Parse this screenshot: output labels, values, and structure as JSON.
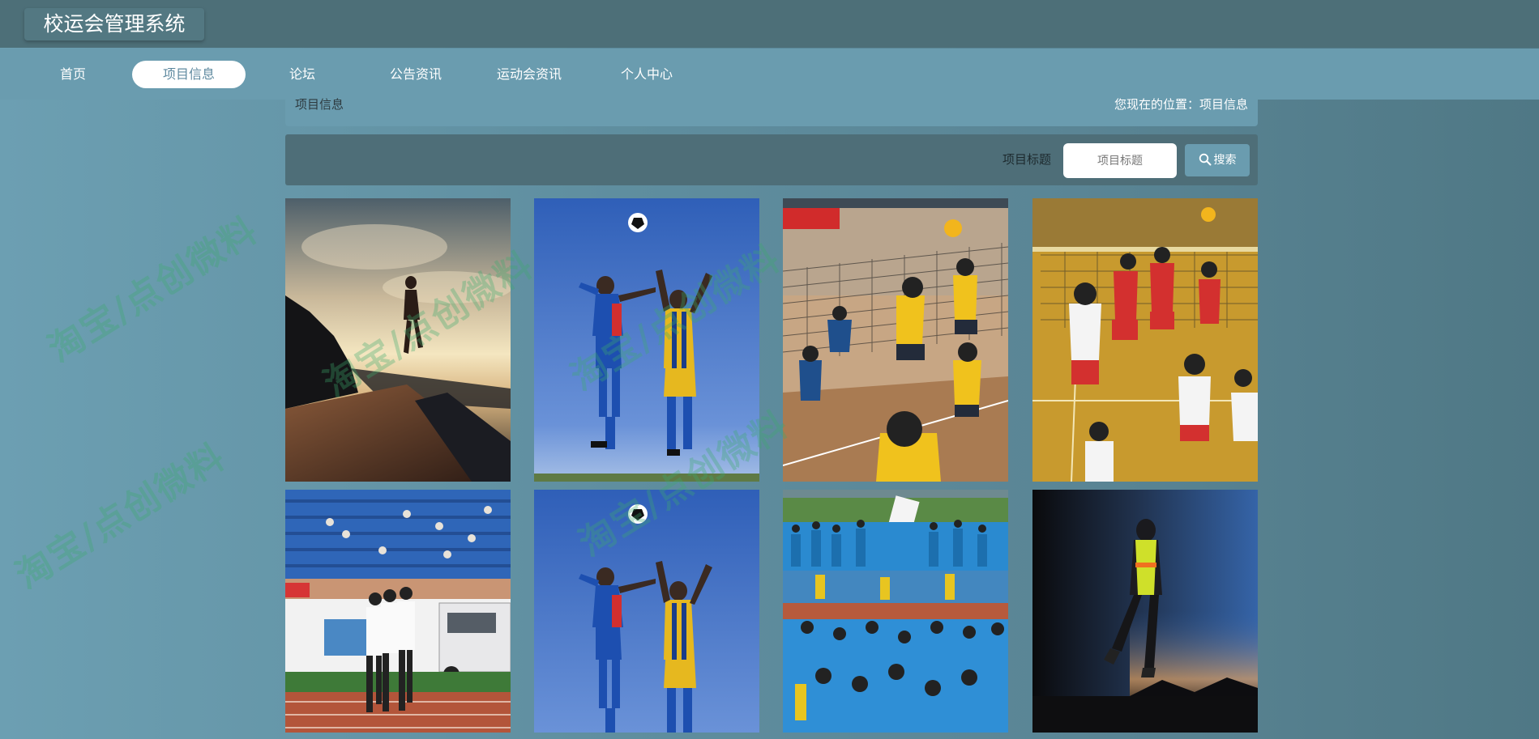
{
  "header": {
    "title": "校运会管理系统"
  },
  "nav": {
    "items": [
      {
        "label": "首页"
      },
      {
        "label": "项目信息"
      },
      {
        "label": "论坛"
      },
      {
        "label": "公告资讯"
      },
      {
        "label": "运动会资讯"
      },
      {
        "label": "个人中心"
      }
    ],
    "active": "项目信息"
  },
  "breadcrumb": {
    "title": "项目信息",
    "location": "您现在的位置：项目信息"
  },
  "search": {
    "label": "项目标题",
    "placeholder": "项目标题",
    "value": "",
    "button_label": "搜索",
    "button_icon": "search-icon"
  },
  "grid": {
    "items": [
      {
        "image": "runner-at-sunset-on-boardwalk"
      },
      {
        "image": "two-soccer-players-heading-ball"
      },
      {
        "image": "womens-volleyball-match-at-net"
      },
      {
        "image": "womens-volleyball-block-red-vs-white"
      },
      {
        "image": "relay-runners-on-track-near-stands"
      },
      {
        "image": "two-soccer-players-heading-ball"
      },
      {
        "image": "crowd-of-students-at-sports-meet"
      },
      {
        "image": "night-runner-in-reflective-vest"
      }
    ]
  },
  "watermark": {
    "text": "淘宝/点创微料"
  },
  "colors": {
    "header_bg": "#4d6f78",
    "nav_bg": "#6a9caf",
    "panel_bg": "#4e6e78",
    "accent": "#6a9caf"
  }
}
